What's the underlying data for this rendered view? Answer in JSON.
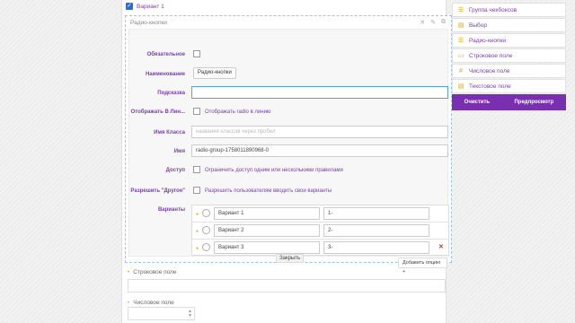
{
  "header_option": {
    "label": "Вариант 1",
    "checked": true
  },
  "editor": {
    "title": "Радио-кнопки",
    "icons": [
      "close-icon",
      "edit-icon",
      "copy-icon"
    ],
    "fields": {
      "required": {
        "label": "Обязательное"
      },
      "name": {
        "label": "Наименование",
        "value": "Радио-кнопки"
      },
      "hint": {
        "label": "Подсказка",
        "value": ""
      },
      "inline": {
        "label": "Отображать В Лин...",
        "text": "Отображать radio в линию"
      },
      "class_name": {
        "label": "Имя Класса",
        "placeholder": "названия классов через пробел"
      },
      "field_name": {
        "label": "Имя",
        "value": "radio-group-1758011890968-0"
      },
      "access": {
        "label": "Доступ",
        "text": "Ограничить доступ одним или несколькими правилами"
      },
      "allow_other": {
        "label": "Разрешить \"Другое\"",
        "text": "Разрешить пользователям вводить свои варианты"
      },
      "options": {
        "label": "Варианты",
        "rows": [
          {
            "label": "Вариант 1",
            "value": "1-"
          },
          {
            "label": "Вариант 2",
            "value": "2-"
          },
          {
            "label": "Вариант 3",
            "value": "3-"
          }
        ],
        "add_button": "Добавить опцию +"
      }
    },
    "close_label": "Закрыть"
  },
  "below": [
    {
      "title": "Строковое поле"
    },
    {
      "title": "Числовое поле"
    }
  ],
  "toolbox": {
    "items": [
      {
        "icon": "checkbox-group-icon",
        "label": "Группа чекбоксов"
      },
      {
        "icon": "select-icon",
        "label": "Выбор"
      },
      {
        "icon": "radio-group-icon",
        "label": "Радио-кнопки"
      },
      {
        "icon": "text-field-icon",
        "label": "Строковое поле"
      },
      {
        "icon": "hash-icon",
        "label": "Числовое поле"
      },
      {
        "icon": "textarea-icon",
        "label": "Текстовое поле"
      }
    ],
    "clear": "Очистить",
    "preview": "Предпросмотр"
  },
  "colors": {
    "accent": "#7a2fb0",
    "label": "#7b3ea8",
    "marker": "#e2b400"
  }
}
